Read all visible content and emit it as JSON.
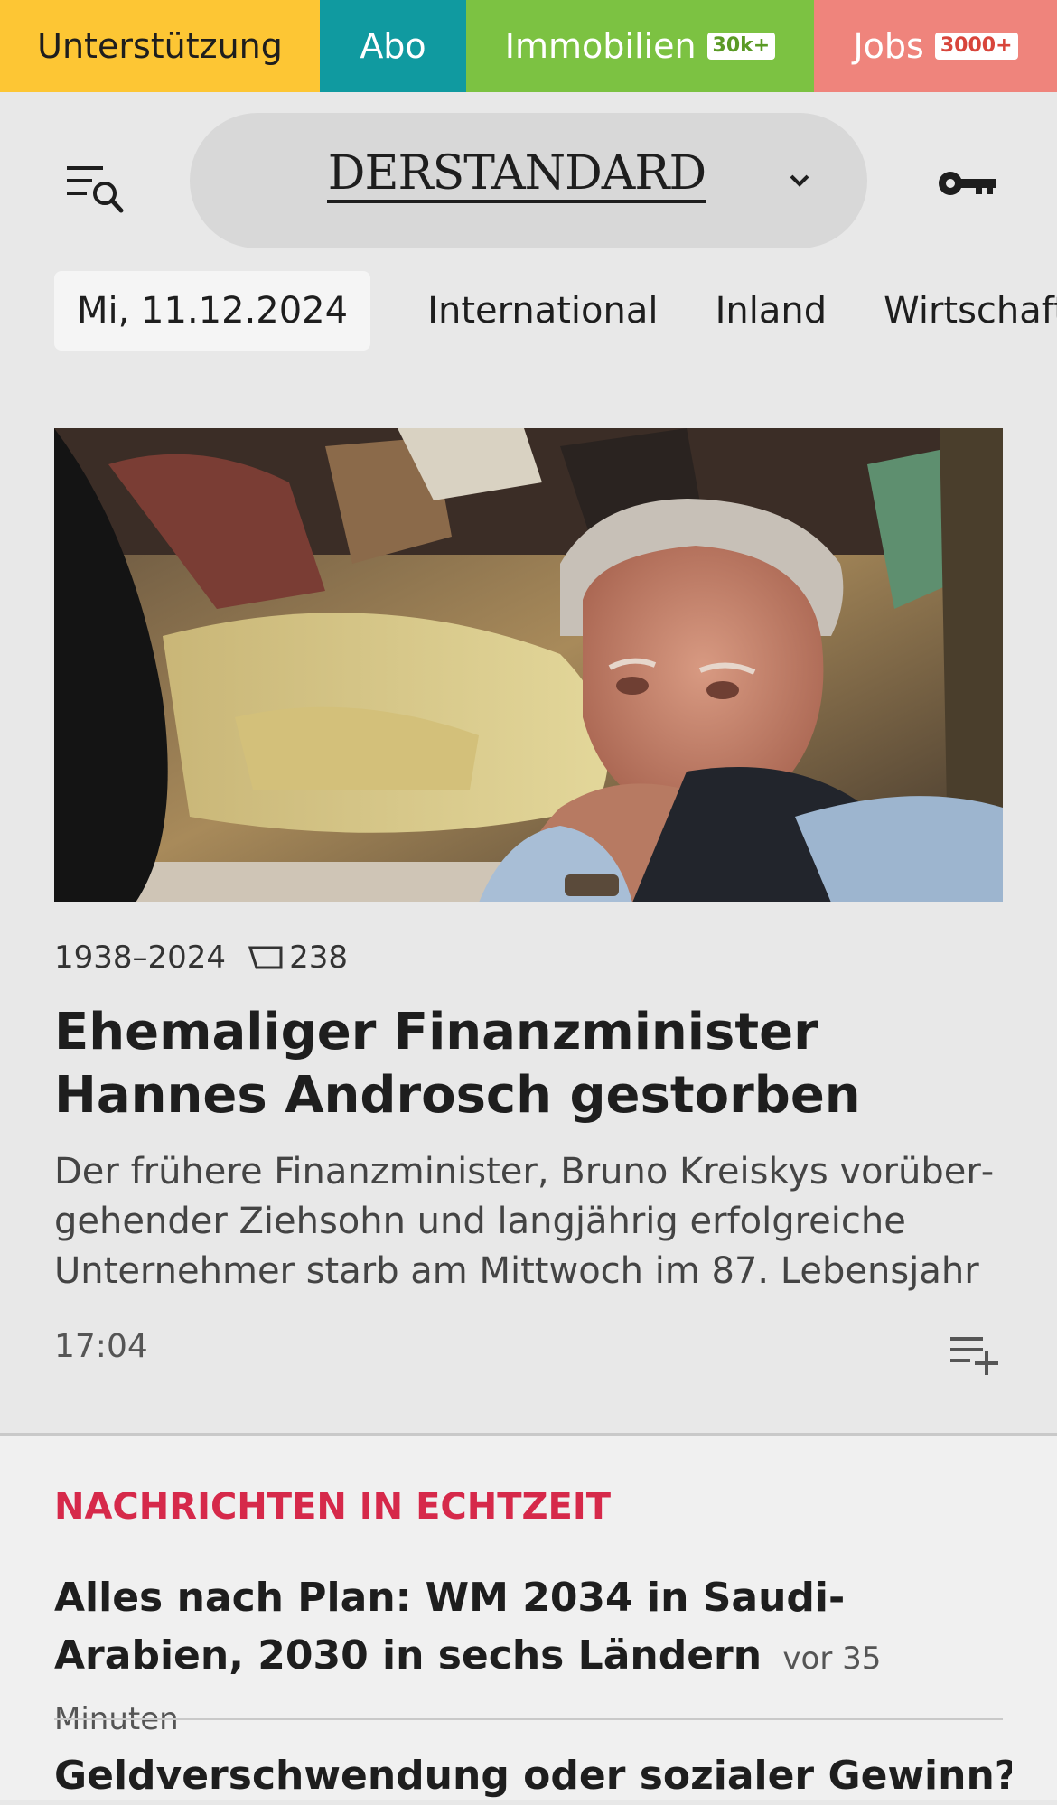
{
  "topbar": {
    "support_label": "Unterstützung",
    "abo_label": "Abo",
    "immobilien_label": "Immobilien",
    "immobilien_badge": "30k+",
    "jobs_label": "Jobs",
    "jobs_badge": "3000+",
    "colors": {
      "support": "#fdc634",
      "abo": "#109aa0",
      "immobilien": "#7cc242",
      "jobs": "#ef847c"
    }
  },
  "header": {
    "logo_text": "DERSTANDARD",
    "menu_icon": "menu-search-icon",
    "key_icon": "key-icon",
    "chevron_icon": "chevron-down-icon"
  },
  "nav": {
    "date": "Mi, 11.12.2024",
    "items": [
      "International",
      "Inland",
      "Wirtschaft"
    ]
  },
  "hero": {
    "kicker": "1938–2024",
    "comment_count": "238",
    "headline": "Ehemaliger Finanzminister Hannes Androsch gestorben",
    "lead": "Der frühere Finanzminister, Bruno Kreiskys vorüber­gehender Ziehsohn und langjährig erfolgreiche Unternehmer starb am Mittwoch im 87. Lebensjahr",
    "time": "17:04",
    "playlist_icon": "playlist-add-icon"
  },
  "live": {
    "title": "NACHRICHTEN IN ECHTZEIT",
    "accent": "#d6294a",
    "items": [
      {
        "title": "Alles nach Plan: WM 2034 in Saudi-Arabien, 2030 in sechs Ländern",
        "ago": "vor 35 Minuten"
      },
      {
        "title": "Geldverschwendung oder sozialer Gewinn? Wie"
      }
    ]
  }
}
